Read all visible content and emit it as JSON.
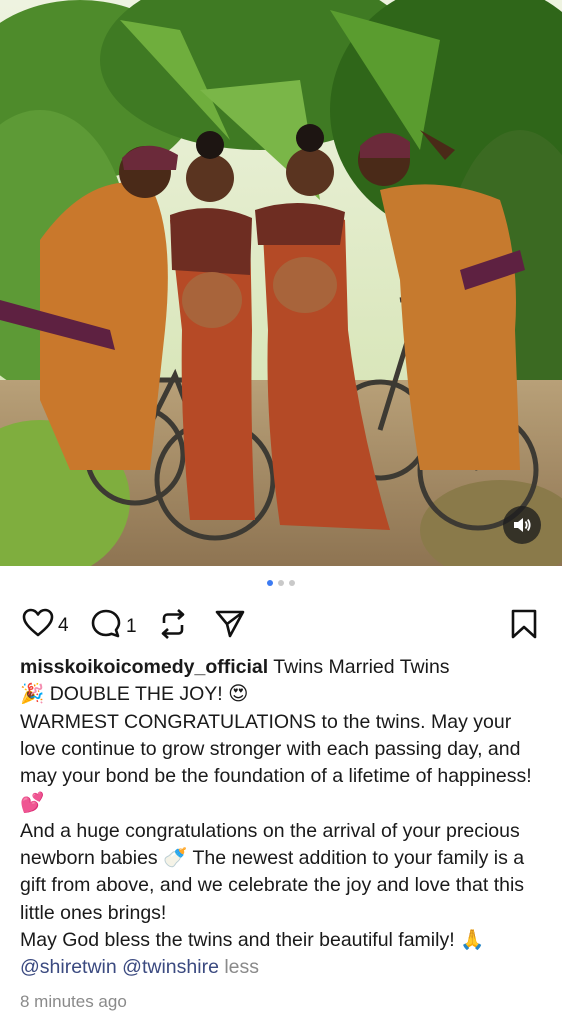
{
  "post": {
    "image": {
      "description_icon": "photo",
      "sound_icon": "speaker-icon"
    },
    "carousel": {
      "count": 3,
      "active": 0
    },
    "actions": {
      "likes": "4",
      "comments": "1"
    },
    "caption": {
      "username": "misskoikoicomedy_official",
      "title": "Twins Married Twins",
      "line1": "🎉 DOUBLE THE JOY! 😍",
      "para1": "WARMEST CONGRATULATIONS to the twins. May your love continue to grow stronger with each passing day, and may your bond be the foundation of a lifetime of happiness! 💕",
      "para2": "And a huge congratulations on the arrival of your precious newborn babies 🍼 The newest addition to your family is a gift from above, and we celebrate the joy and love that this little ones brings!",
      "para3": "May God bless the twins and their beautiful family! 🙏",
      "mention1": "@shiretwin",
      "mention2": "@twinshire",
      "less": "less"
    },
    "timestamp": "8 minutes ago"
  },
  "colors": {
    "accent_dot": "#3d7bf2",
    "mention": "#3b4a80",
    "muted": "#8a8a8a"
  }
}
